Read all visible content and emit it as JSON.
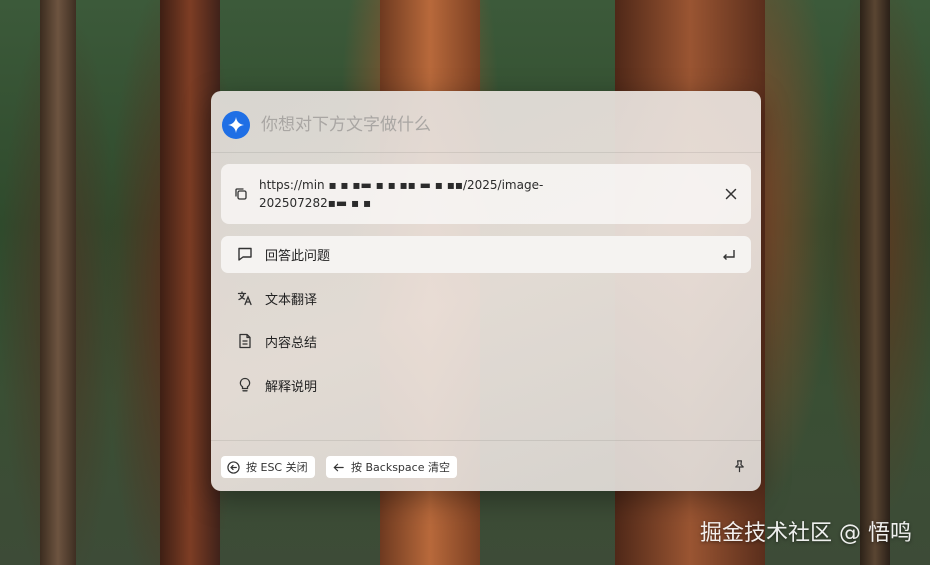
{
  "query": {
    "placeholder": "你想对下方文字做什么"
  },
  "selection": {
    "url_line1": "https://min ▪ ▪ ▪▬ ▪ ▪ ▪▪ ▬ ▪ ▪▪/2025/image-",
    "url_line2": "202507282▪▬ ▪ ▪"
  },
  "actions": [
    {
      "label": "回答此问题",
      "icon": "chat-bubble-icon",
      "selected": true
    },
    {
      "label": "文本翻译",
      "icon": "translate-icon",
      "selected": false
    },
    {
      "label": "内容总结",
      "icon": "document-icon",
      "selected": false
    },
    {
      "label": "解释说明",
      "icon": "lightbulb-icon",
      "selected": false
    }
  ],
  "footer": {
    "esc_hint": "按 ESC 关闭",
    "backspace_hint": "按 Backspace 清空"
  },
  "watermark": "掘金技术社区 @ 悟鸣",
  "colors": {
    "accent": "#1f6fe5",
    "panel": "#e4e0dc"
  }
}
